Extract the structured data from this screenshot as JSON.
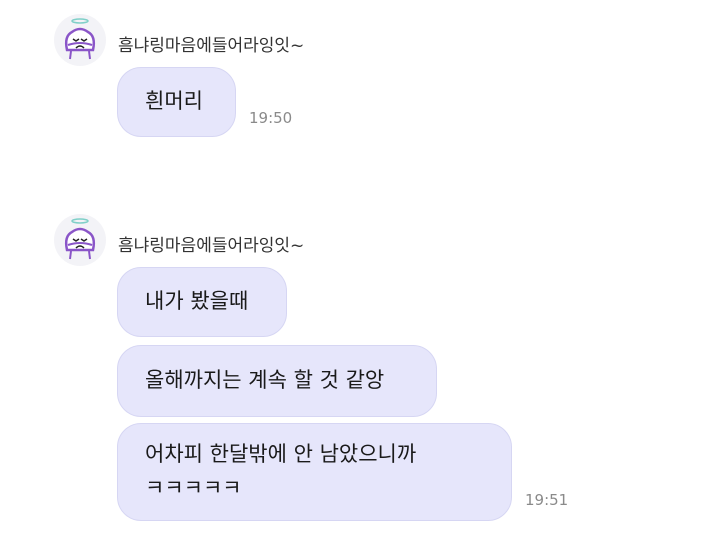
{
  "messages": {
    "group1": {
      "sender": "흠냐링마음에들어라잉잇~",
      "bubbles": [
        "흰머리"
      ],
      "time": "19:50"
    },
    "group2": {
      "sender": "흠냐링마음에들어라잉잇~",
      "bubbles": [
        "내가 봤을때",
        "올해까지는 계속 할 것 같앙"
      ],
      "last_bubble_lines": [
        "어차피 한달밖에 안 남았으니까",
        "ㅋㅋㅋㅋㅋ"
      ],
      "time": "19:51"
    }
  },
  "colors": {
    "bubble": "#e6e6fb",
    "bubble_border": "#d6d6f3",
    "avatar_accent": "#8a55c8"
  },
  "icons": {
    "avatar": "cartoon-face-with-halo-icon"
  }
}
